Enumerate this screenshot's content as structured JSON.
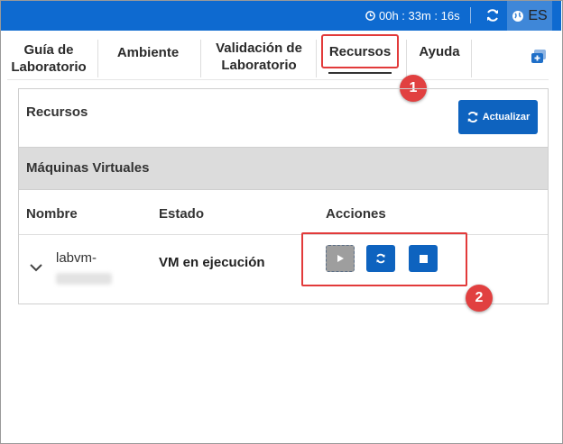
{
  "topbar": {
    "timer": "00h : 33m : 16s",
    "language": "ES",
    "icons": [
      "clock-icon",
      "refresh-icon",
      "globe-icon"
    ]
  },
  "tabs": [
    {
      "label_line1": "Guía de",
      "label_line2": "Laboratorio"
    },
    {
      "label_line1": "Ambiente",
      "label_line2": ""
    },
    {
      "label_line1": "Validación de",
      "label_line2": "Laboratorio"
    },
    {
      "label_line1": "Recursos",
      "label_line2": "",
      "active": true
    },
    {
      "label_line1": "Ayuda",
      "label_line2": ""
    }
  ],
  "callouts": [
    "1",
    "2"
  ],
  "resources": {
    "title": "Recursos",
    "update_button": "Actualizar",
    "vm_section_title": "Máquinas Virtuales",
    "columns": {
      "name": "Nombre",
      "state": "Estado",
      "actions": "Acciones"
    },
    "vm": {
      "name": "labvm-",
      "state": "VM en ejecución"
    }
  },
  "colors": {
    "topbar": "#0e6ad0",
    "accent": "#0e63bf",
    "highlight": "#e23a3a"
  }
}
